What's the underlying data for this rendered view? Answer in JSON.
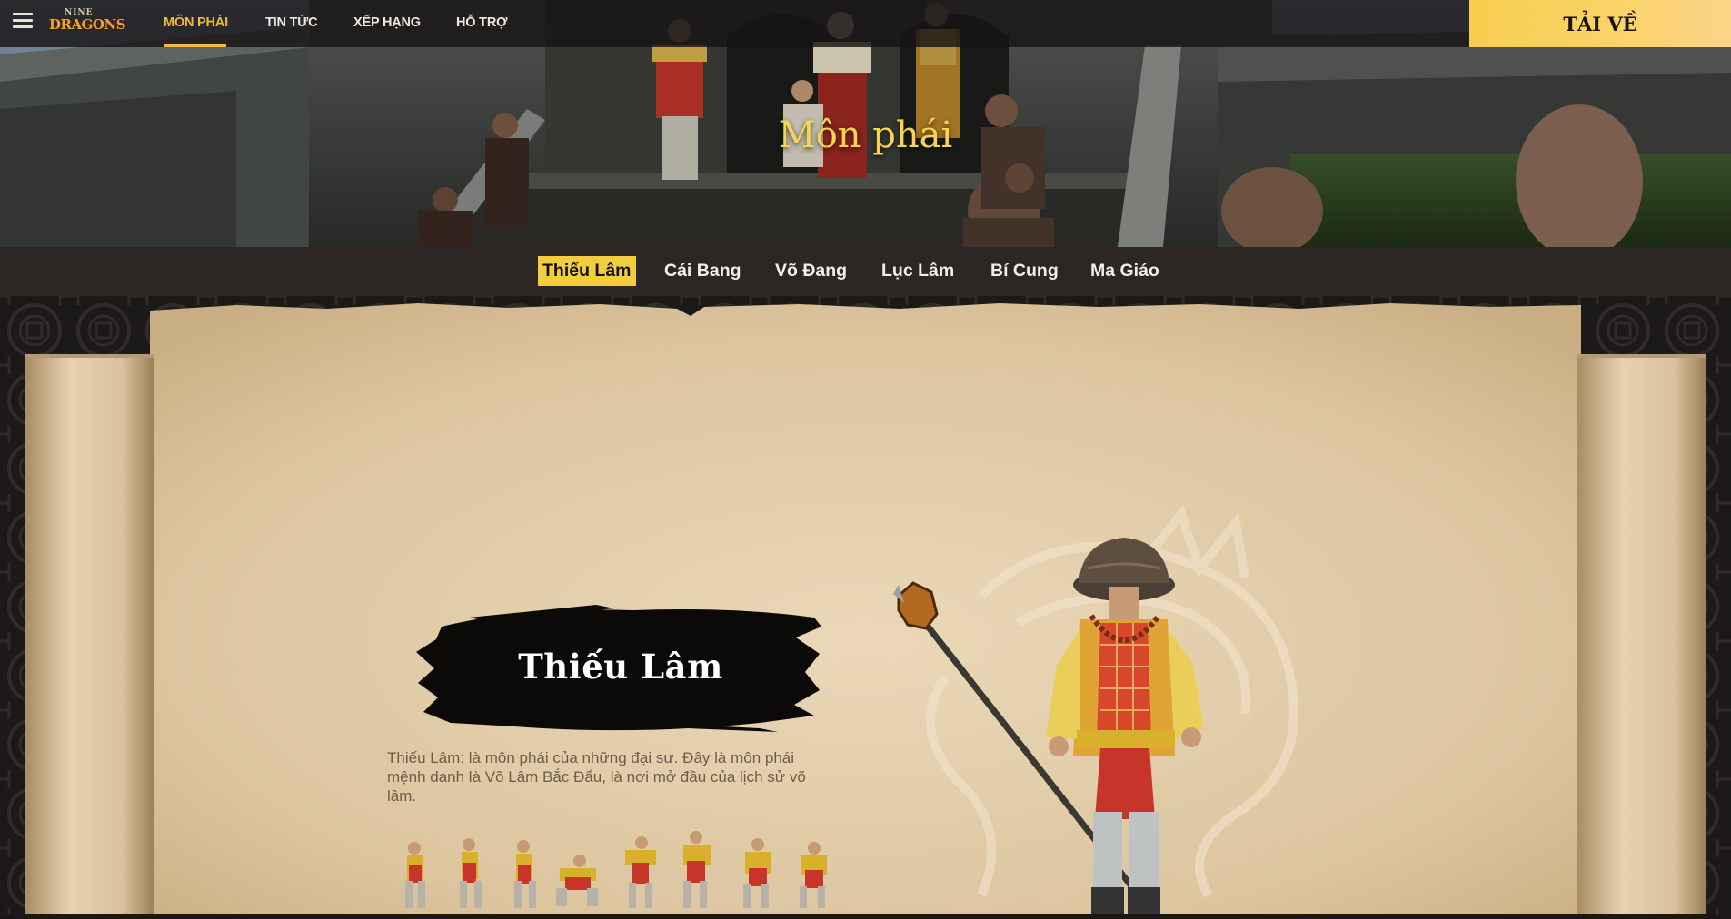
{
  "topnav": {
    "logo_line1": "NINE",
    "logo_line2": "DRAGONS",
    "links": [
      {
        "label": "MÔN PHÁI",
        "active": true
      },
      {
        "label": "TIN TỨC",
        "active": false
      },
      {
        "label": "XẾP HẠNG",
        "active": false
      },
      {
        "label": "HỖ TRỢ",
        "active": false
      }
    ],
    "download_label": "TẢI VỀ"
  },
  "hero": {
    "title": "Môn phái"
  },
  "factions": {
    "tabs": [
      {
        "label": "Thiếu Lâm",
        "active": true
      },
      {
        "label": "Cái Bang",
        "active": false
      },
      {
        "label": "Võ Đang",
        "active": false
      },
      {
        "label": "Lục Lâm",
        "active": false
      },
      {
        "label": "Bí Cung",
        "active": false
      },
      {
        "label": "Ma Giáo",
        "active": false
      }
    ]
  },
  "content": {
    "faction_title": "Thiếu Lâm",
    "description": "Thiếu Lâm: là môn phái của những đại sư. Đây là môn phái mệnh danh là Võ Lâm Bắc Đẩu, là nơi mở đầu của lịch sử võ lâm."
  },
  "colors": {
    "accent": "#f2cd3e",
    "nav_active": "#f0b840",
    "parchment": "#e5d2b1",
    "tabbar": "#2c2624"
  },
  "icons": {
    "menu": "hamburger-menu-icon"
  }
}
